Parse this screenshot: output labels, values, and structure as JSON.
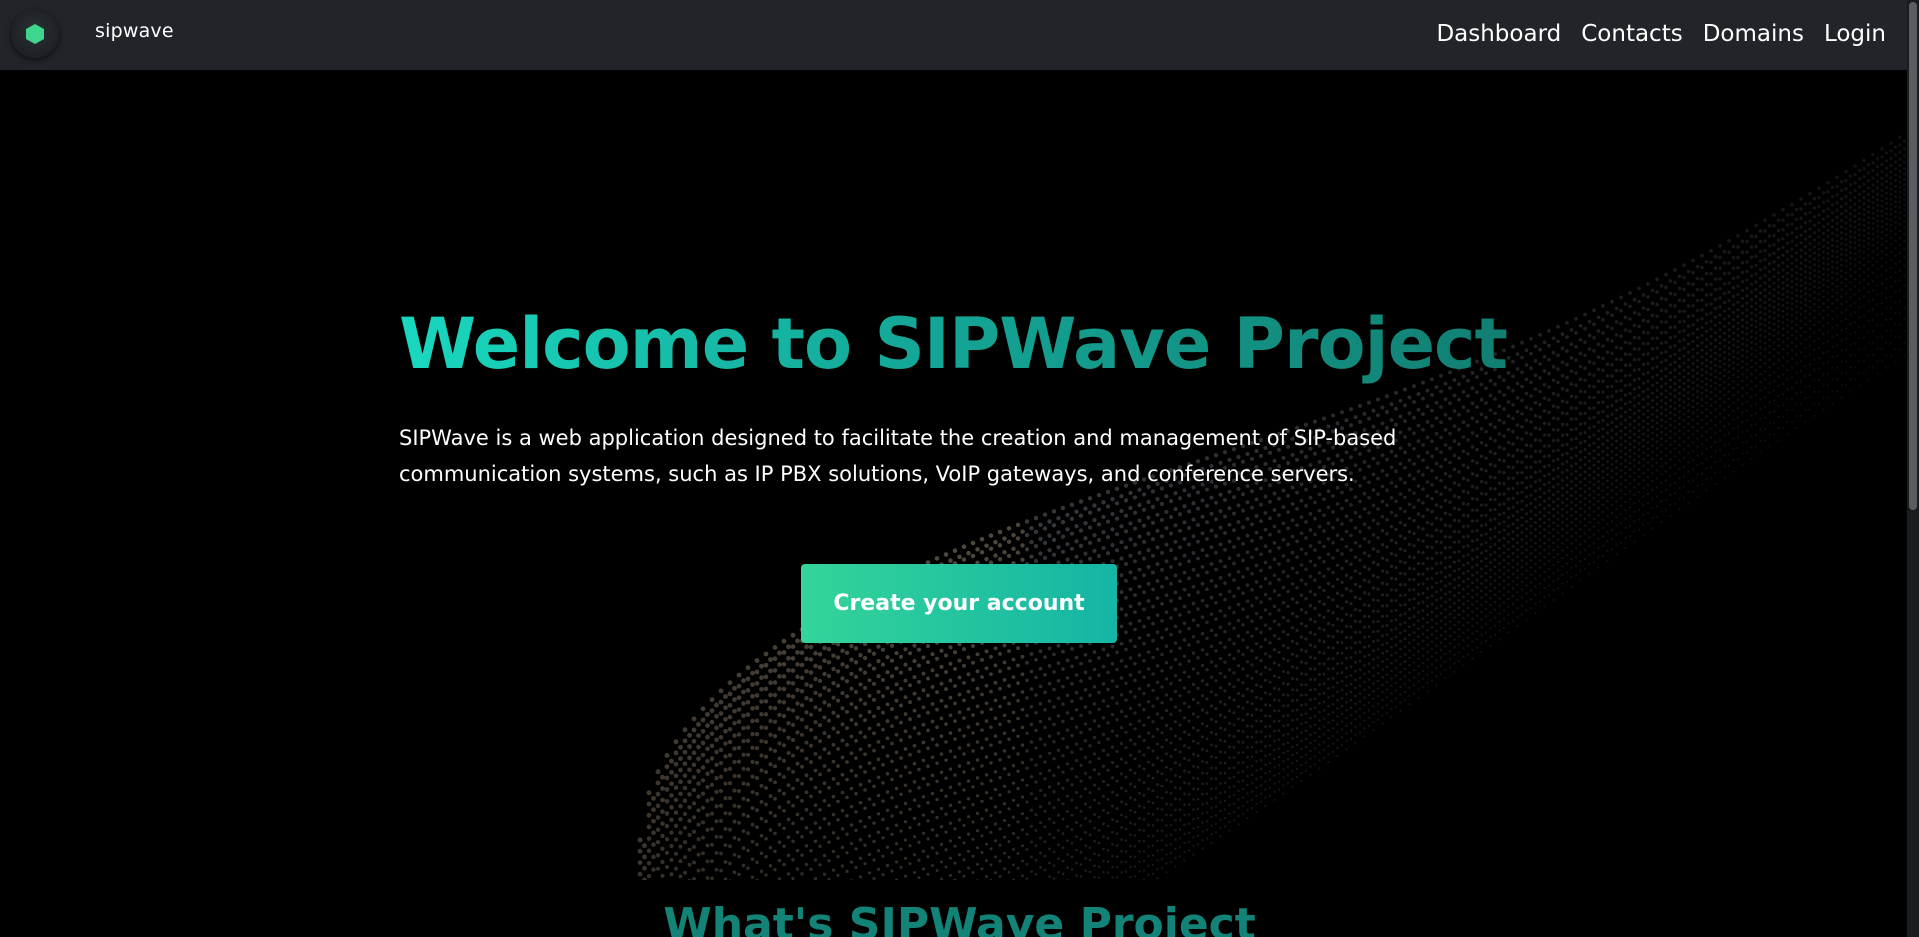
{
  "header": {
    "brand": "sipwave",
    "logo_icon": "hexagon-logo-icon",
    "logo_color": "#3dd68c",
    "nav": [
      {
        "label": "Dashboard"
      },
      {
        "label": "Contacts"
      },
      {
        "label": "Domains"
      },
      {
        "label": "Login"
      }
    ]
  },
  "hero": {
    "title": "Welcome to SIPWave Project",
    "description": "SIPWave is a web application designed to facilitate the creation and management of SIP-based communication systems, such as IP PBX solutions, VoIP gateways, and conference servers.",
    "cta_label": "Create your account"
  },
  "next_section": {
    "title": "What's SIPWave Project"
  },
  "colors": {
    "header_bg": "#212428",
    "page_bg": "#000000",
    "accent_teal": "#14b5a4",
    "accent_green": "#34d49a"
  }
}
